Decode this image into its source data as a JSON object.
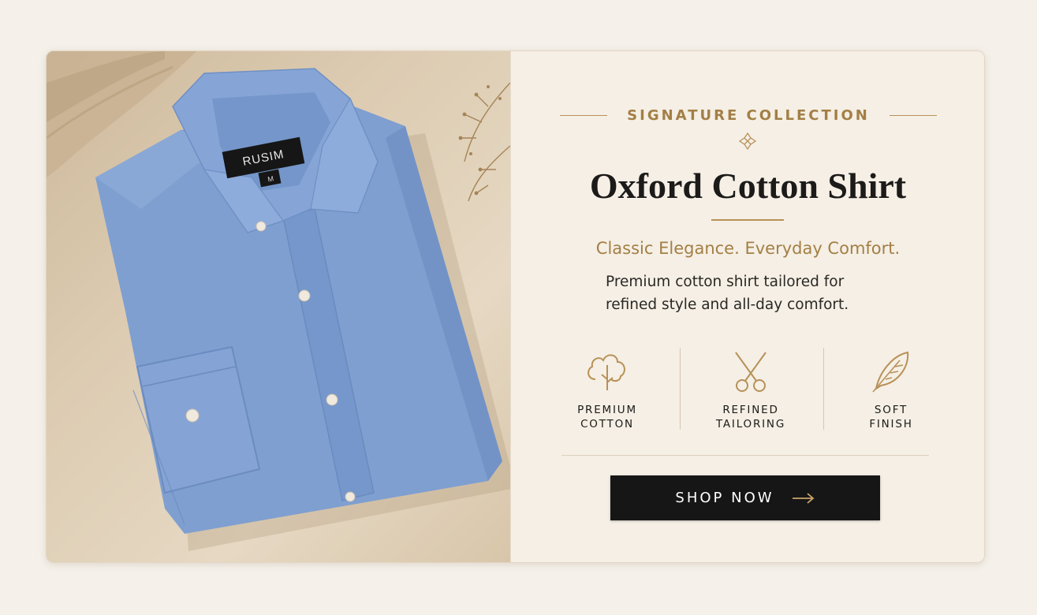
{
  "hero": {
    "shirt_label_brand": "RUSIM",
    "shirt_label_size": "M",
    "eyebrow": "SIGNATURE COLLECTION",
    "title": "Oxford Cotton Shirt",
    "tagline": "Classic Elegance. Everyday Comfort.",
    "description_line1": "Premium cotton shirt tailored for",
    "description_line2": "refined style and all-day comfort.",
    "features": [
      {
        "icon": "cotton-icon",
        "line1": "PREMIUM",
        "line2": "COTTON"
      },
      {
        "icon": "scissors-icon",
        "line1": "REFINED",
        "line2": "TAILORING"
      },
      {
        "icon": "feather-icon",
        "line1": "SOFT",
        "line2": "FINISH"
      }
    ],
    "cta_label": "SHOP NOW",
    "cta_icon": "arrow-right-icon"
  },
  "colors": {
    "accent_gold": "#b89158",
    "shirt_blue": "#7f9fd0",
    "button_dark": "#161616",
    "panel_bg": "#f5efe5"
  }
}
